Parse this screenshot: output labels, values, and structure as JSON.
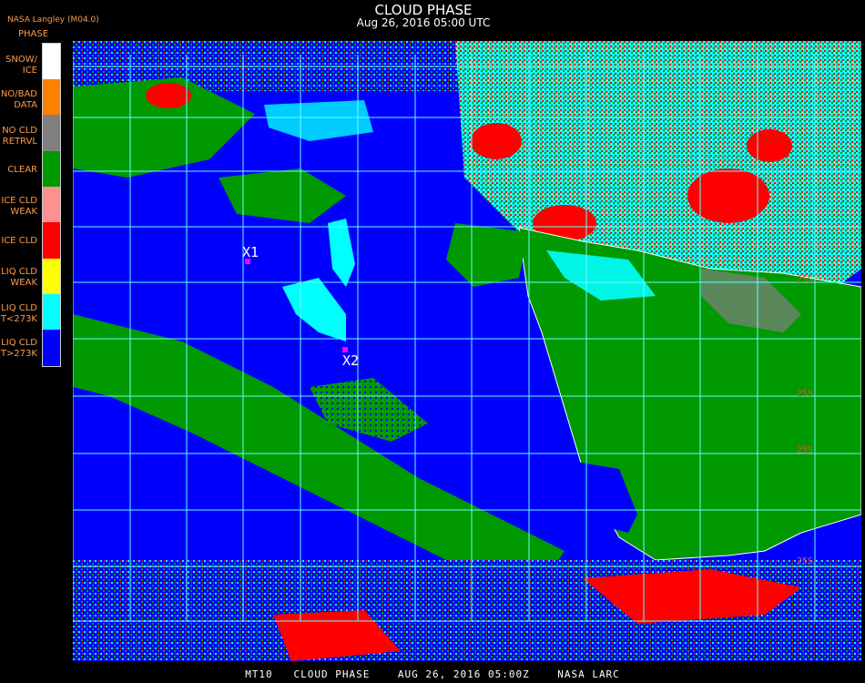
{
  "header": {
    "title": "CLOUD PHASE",
    "date": "Aug 26, 2016 05:00 UTC",
    "credit": "NASA Langley (M04.0)"
  },
  "legend": {
    "title": "PHASE",
    "items": [
      {
        "label": "SNOW/\nICE",
        "color": "#ffffff"
      },
      {
        "label": "NO/BAD\nDATA",
        "color": "#ff8000"
      },
      {
        "label": "NO CLD\nRETRVL",
        "color": "#808080"
      },
      {
        "label": "CLEAR",
        "color": "#009900"
      },
      {
        "label": "ICE CLD\nWEAK",
        "color": "#ff9090"
      },
      {
        "label": "ICE CLD",
        "color": "#ff0000"
      },
      {
        "label": "LIQ CLD\nWEAK",
        "color": "#ffff00"
      },
      {
        "label": "LIQ CLD\nT<273K",
        "color": "#00ffff"
      },
      {
        "label": "LIQ CLD\nT>273K",
        "color": "#0000ff"
      }
    ]
  },
  "markers": [
    {
      "label": "X1"
    },
    {
      "label": "X2"
    }
  ],
  "grid_labels": [
    "25S",
    "25S",
    "25S",
    "25S"
  ],
  "footer": "MT10   CLOUD PHASE    AUG 26, 2016 05:00Z    NASA LARC"
}
